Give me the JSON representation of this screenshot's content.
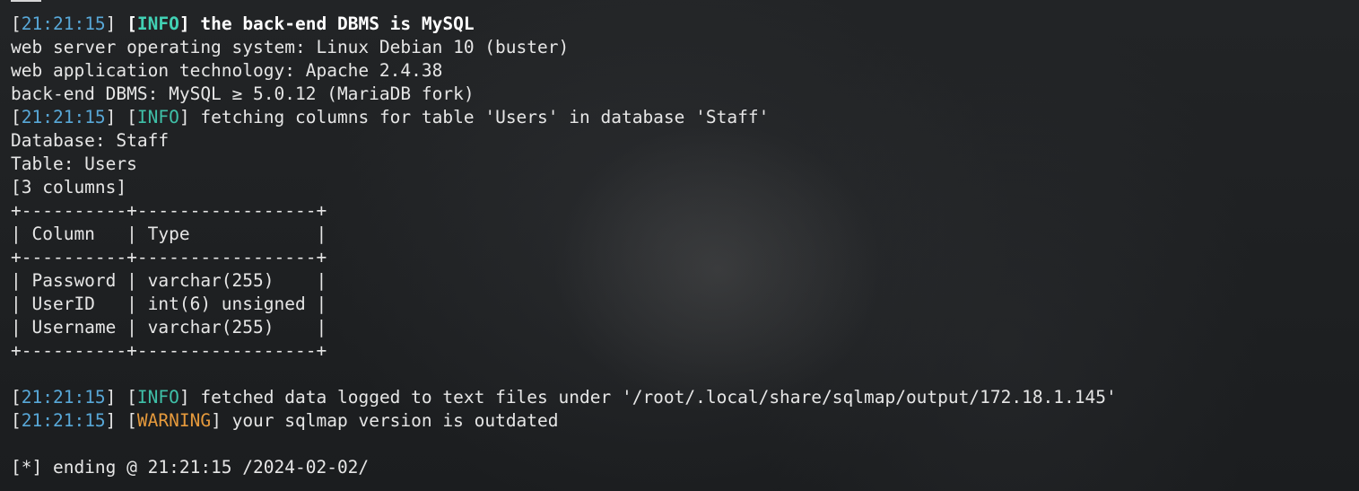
{
  "colors": {
    "timestamp": "#58a8d8",
    "info": "#3fc0a8",
    "warning": "#e69a3c",
    "text": "#e6e6e6",
    "background": "#1c1e20"
  },
  "log": {
    "line1": {
      "ts": "21:21:15",
      "level": "INFO",
      "msg": "the back-end DBMS is MySQL"
    },
    "line2": "web server operating system: Linux Debian 10 (buster)",
    "line3": "web application technology: Apache 2.4.38",
    "line4": "back-end DBMS: MySQL ≥ 5.0.12 (MariaDB fork)",
    "line5": {
      "ts": "21:21:15",
      "level": "INFO",
      "msg": "fetching columns for table 'Users' in database 'Staff'"
    },
    "database": "Database: Staff",
    "table": "Table: Users",
    "columns_count": "[3 columns]"
  },
  "table": {
    "border_top": "+----------+-----------------+",
    "header": "| Column   | Type            |",
    "border_mid": "+----------+-----------------+",
    "rows": [
      "| Password | varchar(255)    |",
      "| UserID   | int(6) unsigned |",
      "| Username | varchar(255)    |"
    ],
    "border_bottom": "+----------+-----------------+"
  },
  "tail": {
    "line1": {
      "ts": "21:21:15",
      "level": "INFO",
      "msg": "fetched data logged to text files under '/root/.local/share/sqlmap/output/172.18.1.145'"
    },
    "line2": {
      "ts": "21:21:15",
      "level": "WARNING",
      "msg": "your sqlmap version is outdated"
    },
    "ending": "[*] ending @ 21:21:15 /2024-02-02/"
  }
}
